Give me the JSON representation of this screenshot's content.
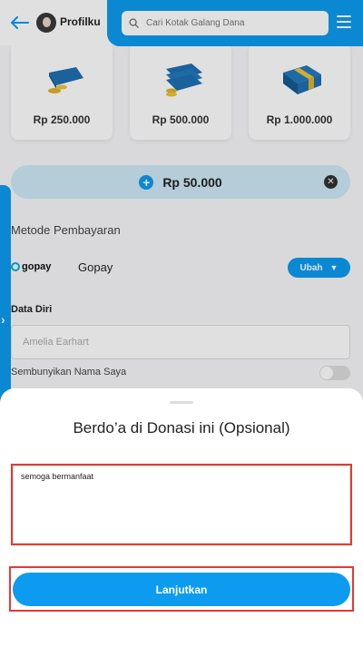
{
  "header": {
    "profile_label": "Profilku",
    "search_placeholder": "Cari Kotak Galang Dana"
  },
  "amount_cards": [
    {
      "label": "Rp 250.000",
      "icon": "money-stack-small-icon"
    },
    {
      "label": "Rp 500.000",
      "icon": "money-stack-medium-icon"
    },
    {
      "label": "Rp 1.000.000",
      "icon": "money-stack-large-icon"
    }
  ],
  "custom_amount": "Rp 50.000",
  "payment": {
    "section_label": "Metode Pembayaran",
    "logo_text": "gopay",
    "method_name": "Gopay",
    "change_label": "Ubah"
  },
  "personal": {
    "section_label": "Data Diri",
    "name_value": "Amelia Earhart",
    "hide_name_label": "Sembunyikan Nama Saya",
    "hide_name_on": false
  },
  "sheet": {
    "title": "Berdo’a di Donasi ini (Opsional)",
    "prayer_text": "semoga bermanfaat",
    "submit_label": "Lanjutkan"
  },
  "colors": {
    "accent": "#0d9bf0",
    "highlight": "#e53935"
  }
}
